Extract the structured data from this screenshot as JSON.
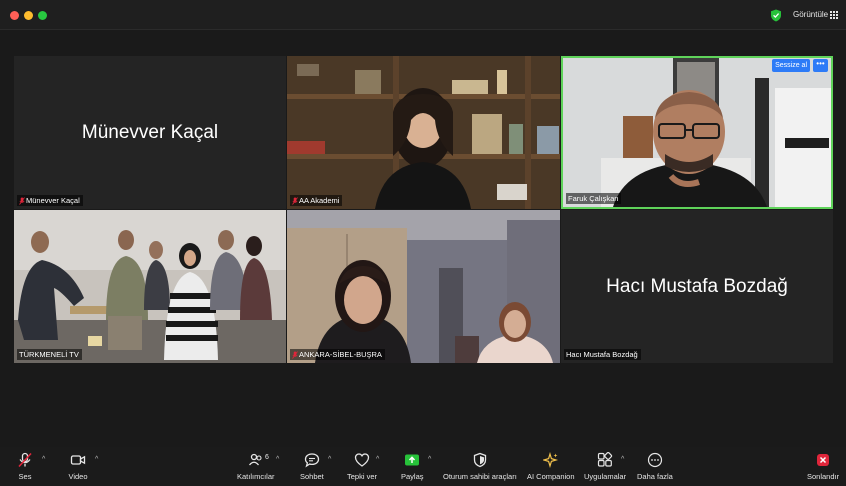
{
  "titlebar": {
    "view_label": "Görüntüle"
  },
  "tiles": {
    "t1": {
      "big_name": "Münevver Kaçal",
      "label": "Münevver Kaçal"
    },
    "t2": {
      "label": "AA Akademi"
    },
    "t3": {
      "label": "Faruk Çalışkan",
      "mute_label": "Sessize al",
      "more_label": "•••"
    },
    "t4": {
      "label": "TÜRKMENELİ TV"
    },
    "t5": {
      "label": "ANKARA-SİBEL-BUŞRA"
    },
    "t6": {
      "big_name": "Hacı Mustafa Bozdağ",
      "label": "Hacı Mustafa Bozdağ"
    }
  },
  "toolbar": {
    "audio": "Ses",
    "video": "Video",
    "participants": "Katılımcılar",
    "participants_count": "6",
    "chat": "Sohbet",
    "react": "Tepki ver",
    "share": "Paylaş",
    "host_tools": "Oturum sahibi araçları",
    "ai_companion": "AI Companion",
    "apps": "Uygulamalar",
    "more": "Daha fazla",
    "end": "Sonlandır"
  },
  "colors": {
    "active_speaker": "#5fd35a",
    "share_green": "#27c23a",
    "end_red": "#e0263b",
    "mute_blue": "#2d7bf7",
    "muted_red": "#e0263b",
    "ai_yellow": "#f2c14b"
  }
}
